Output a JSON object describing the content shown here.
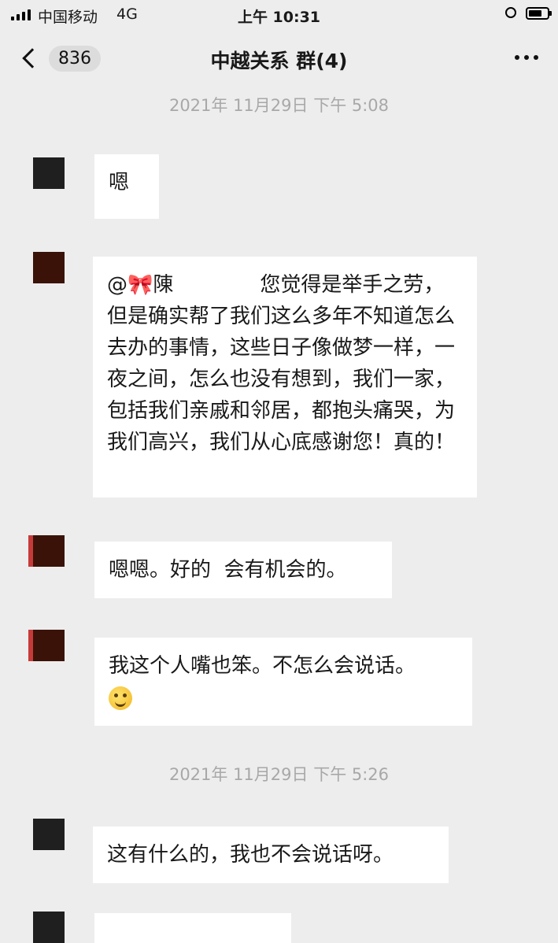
{
  "status_bar": {
    "carrier": "中国移动",
    "network": "4G",
    "time": "上午 10:31"
  },
  "nav": {
    "unread_count": "836",
    "title": "中越关系 群(4)"
  },
  "timestamps": [
    "2021年 11月29日 下午 5:08",
    "2021年 11月29日 下午 5:26"
  ],
  "messages": [
    {
      "text": "嗯"
    },
    {
      "mention": "@🎀陳",
      "text": "您觉得是举手之劳，但是确实帮了我们这么多年不知道怎么去办的事情，这些日子像做梦一样，一夜之间，怎么也没有想到，我们一家，包括我们亲戚和邻居，都抱头痛哭，为我们高兴，我们从心底感谢您！真的！"
    },
    {
      "text": "嗯嗯。好的  会有机会的。"
    },
    {
      "text": "我这个人嘴也笨。不怎么会说话。",
      "emoji": "laugh-cry-emoji"
    },
    {
      "text": "这有什么的，我也不会说话呀。"
    }
  ],
  "colors": {
    "background": "#ededed",
    "bubble": "#ffffff",
    "timestamp": "#a8a8a8",
    "avatar_dark": "#1f1f1f",
    "avatar_brown": "#3a1208",
    "avatar_red_edge": "#c73a3a"
  }
}
